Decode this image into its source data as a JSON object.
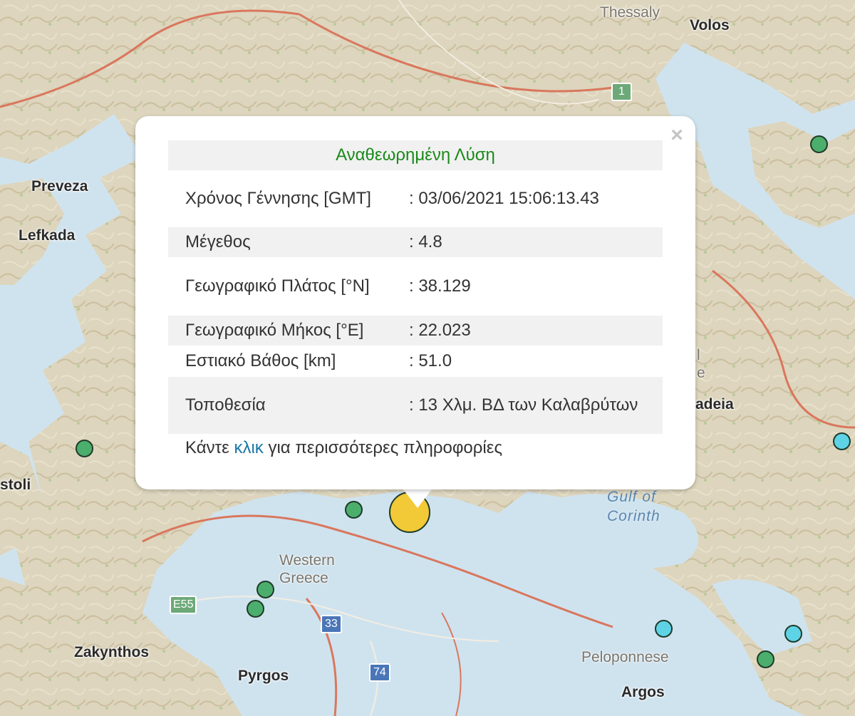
{
  "map": {
    "places": {
      "thessaly": "Thessaly",
      "volos": "Volos",
      "preveza": "Preveza",
      "lefkada": "Lefkada",
      "kefalonia": "stoli",
      "zakynthos": "Zakynthos",
      "pyrgos": "Pyrgos",
      "argos": "Argos",
      "livadeia": "adeia"
    },
    "regions": {
      "western_greece": "Western\nGreece",
      "peloponnese": "Peloponnese",
      "central_fragment": "l\ne"
    },
    "water": {
      "gulf_of_corinth": "Gulf of\nCorinth"
    },
    "shields": {
      "route_1": "1",
      "route_e55": "E55",
      "route_33": "33",
      "route_74": "74"
    },
    "colors": {
      "land": "#ddd5bd",
      "sea": "#cfe3ef",
      "border": "#d9775d",
      "marker_green": "#4cae6c",
      "marker_cyan": "#5ed3e6",
      "marker_selected": "#f2c936"
    }
  },
  "popup": {
    "close_label": "×",
    "title": "Αναθεωρημένη Λύση",
    "rows": [
      {
        "label": "Χρόνος Γέννησης [GMT]",
        "value": ": 03/06/2021 15:06:13.43"
      },
      {
        "label": "Μέγεθος",
        "value": ": 4.8"
      },
      {
        "label": "Γεωγραφικό Πλάτος [°N]",
        "value": ": 38.129"
      },
      {
        "label": "Γεωγραφικό Μήκος [°E]",
        "value": ": 22.023"
      },
      {
        "label": "Εστιακό Βάθος [km]",
        "value": ": 51.0"
      },
      {
        "label": "Τοποθεσία",
        "value": ": 13 Χλμ. ΒΔ των Καλαβρύτων"
      }
    ],
    "more_prefix": "Κάντε ",
    "more_link": "κλικ",
    "more_suffix": " για περισσότερες πληροφορίες"
  }
}
